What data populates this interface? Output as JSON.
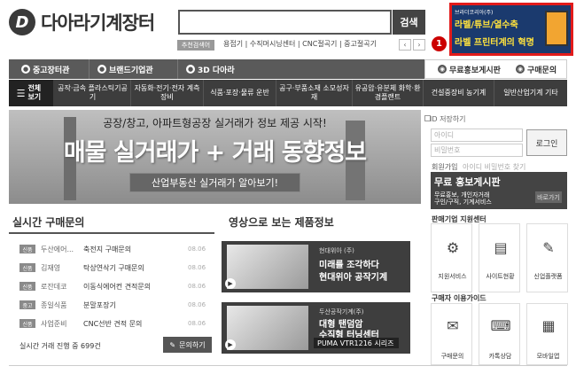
{
  "header": {
    "logo_mark": "D",
    "logo_text": "다아라기계장터",
    "search_placeholder": "",
    "search_button": "검색",
    "reco_badge": "추천검색어",
    "reco_links": "용접기 | 수직머시닝센터 | CNC절곡기 | 중고절곡기",
    "prev": "‹",
    "next": "›"
  },
  "ad": {
    "top": "브라더코리아(주)",
    "line1": "라벨/튜브/열수축",
    "line2": "라벨 프린터계의 혁명",
    "marker": "1"
  },
  "tabs": {
    "used": "중고장터관",
    "brand": "브랜드기업관",
    "d3": "3D 다아라",
    "promo_board": "무료홍보게시판",
    "purchase": "구매문의"
  },
  "categories": {
    "all": "전체 보기",
    "items": [
      "공작·금속 플라스틱기공기",
      "자동화·전기·전자 계측장비",
      "식품·포장·물류 운반",
      "공구·부품소재 소모성자재",
      "유공압·유분체 화학·환경플랜트",
      "건설중장비 농기계",
      "일반산업기계 기타"
    ]
  },
  "hero": {
    "subtitle": "공장/창고, 아파트형공장 실거래가 정보 제공 시작!",
    "title": "매물 실거래가 + 거래 동향정보",
    "cta": "산업부동산 실거래가 알아보기!"
  },
  "login": {
    "keep": "ID 저장하기",
    "id_placeholder": "아이디",
    "pw_placeholder": "비밀번호",
    "button": "로그인",
    "join": "회원가입",
    "find": "아이디 비밀번호 찾기"
  },
  "promo": {
    "title": "무료 홍보게시판",
    "line1": "무료홍보, 개인자거래",
    "line2": "구인/구직, 기계서비스",
    "cta": "바로가기"
  },
  "live": {
    "title": "실시간 구매문의",
    "rows": [
      {
        "badge": "신품",
        "company": "두산에어...",
        "subject": "축전지 구매문의",
        "date": "08.06"
      },
      {
        "badge": "신품",
        "company": "김재영",
        "subject": "탁상연삭기 구매문의",
        "date": "08.06"
      },
      {
        "badge": "신품",
        "company": "로잔데코",
        "subject": "이동식에어컨 견적문의",
        "date": "08.06"
      },
      {
        "badge": "중고",
        "company": "종일식품",
        "subject": "분말포장기",
        "date": "08.06"
      },
      {
        "badge": "신품",
        "company": "사업준비",
        "subject": "CNC선반 견적 문의",
        "date": "08.06"
      }
    ],
    "count_text": "실시간 거래 진행 중 699건",
    "button": "문의하기"
  },
  "video": {
    "title": "영상으로 보는 제품정보",
    "cards": [
      {
        "small": "현대위아 (주)",
        "line1": "미래를 조각하다",
        "line2": "현대위아 공작기계",
        "strip": ""
      },
      {
        "small": "두산공작기계(주)",
        "line1": "대형 탠덤암",
        "line2": "수직형 터닝센터",
        "strip": "PUMA VTR1216 시리즈"
      }
    ]
  },
  "seller": {
    "title": "판매기업 지원센터",
    "items": [
      {
        "label": "지원서비스",
        "icon": "⚙"
      },
      {
        "label": "사이트현황",
        "icon": "▤"
      },
      {
        "label": "신업플랫폼",
        "icon": "✎"
      }
    ]
  },
  "buyer": {
    "title": "구매자 이용가이드",
    "items": [
      {
        "label": "구매문의",
        "icon": "✉"
      },
      {
        "label": "카톡상담",
        "icon": "⌨"
      },
      {
        "label": "모바일앱",
        "icon": "▦"
      }
    ]
  }
}
